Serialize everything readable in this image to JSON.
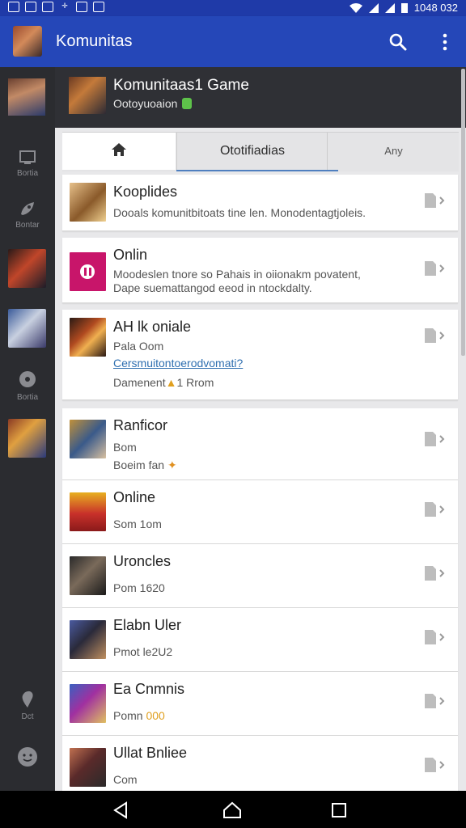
{
  "status_bar": {
    "time": "1048 032"
  },
  "app_bar": {
    "title": "Komunitas",
    "search_icon": "search-icon",
    "more_icon": "more-vertical-icon"
  },
  "sidebar": {
    "items": [
      {
        "label": "Bortia",
        "icon": "monitor-icon"
      },
      {
        "label": "Bontar",
        "icon": "rocket-icon"
      },
      {
        "label": "Bortia",
        "icon": "chat-bubble-icon"
      },
      {
        "label": "Dct",
        "icon": "location-pin-icon"
      },
      {
        "label": "",
        "icon": "emoji-icon"
      }
    ]
  },
  "game_header": {
    "title": "Komunitaas1 Game",
    "subtitle": "Ootoyuoaion"
  },
  "tabs": {
    "home_icon": "home-icon",
    "notifications": "Ototifiadias",
    "any": "Any"
  },
  "cards": [
    {
      "title": "Kooplides",
      "lines": [
        "Dooals komunitbitoats tine len. Monodentagtjoleis."
      ],
      "color": "#c9a26a"
    },
    {
      "title": "Onlin",
      "lines": [
        "Moodeslen tnore so Pahais in oiionakm povatent,",
        "Dape suemattangod eeod in ntockdalty."
      ],
      "color": "#d0206e"
    },
    {
      "title": "AH lk oniale",
      "lines": [
        "Pala Oom",
        "Cersmuitontoerodvomati?",
        "Damenent",
        "1 Rrom"
      ],
      "color": "#8a3a24"
    },
    {
      "title": "Ranficor",
      "lines": [
        "Bom",
        "Boeim fan"
      ],
      "color": "#b07a3a"
    },
    {
      "title": "Online",
      "lines": [
        "Som 1om"
      ],
      "color": "#d6a020"
    },
    {
      "title": "Uroncles",
      "lines": [
        "Pom 1620"
      ],
      "color": "#6a5040"
    },
    {
      "title": "Elabn Uler",
      "lines": [
        "Pmot le2U2"
      ],
      "color": "#3a4a7a"
    },
    {
      "title": "Ea Cnmnis",
      "lines": [
        "Pomn",
        "000"
      ],
      "color": "#6a3a9a"
    },
    {
      "title": "Ullat Bnliee",
      "lines": [
        "Com"
      ],
      "color": "#7a3a3a"
    }
  ],
  "nav_bar": {
    "back_icon": "back-icon",
    "home_icon": "home-icon",
    "recents_icon": "recents-icon"
  }
}
